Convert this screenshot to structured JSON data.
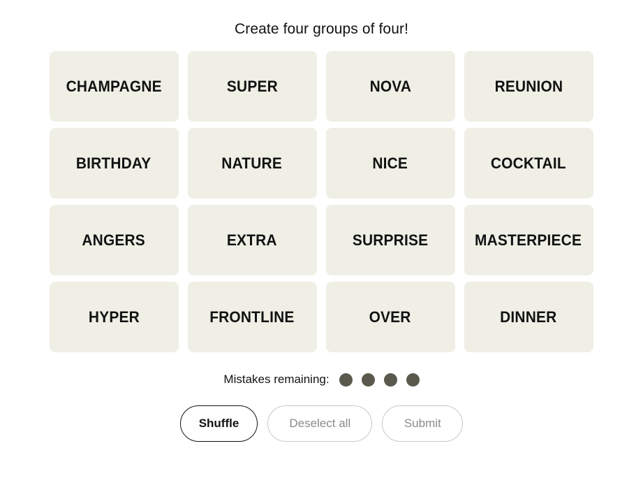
{
  "game": {
    "title": "Create four groups of four!",
    "tiles": [
      {
        "label": "CHAMPAGNE"
      },
      {
        "label": "SUPER"
      },
      {
        "label": "NOVA"
      },
      {
        "label": "REUNION"
      },
      {
        "label": "BIRTHDAY"
      },
      {
        "label": "NATURE"
      },
      {
        "label": "NICE"
      },
      {
        "label": "COCKTAIL"
      },
      {
        "label": "ANGERS"
      },
      {
        "label": "EXTRA"
      },
      {
        "label": "SURPRISE"
      },
      {
        "label": "MASTERPIECE"
      },
      {
        "label": "HYPER"
      },
      {
        "label": "FRONTLINE"
      },
      {
        "label": "OVER"
      },
      {
        "label": "DINNER"
      }
    ],
    "mistakes": {
      "label": "Mistakes remaining:",
      "remaining": 4,
      "dot_color": "#5a594e"
    },
    "buttons": {
      "shuffle": "Shuffle",
      "deselect_all": "Deselect all",
      "submit": "Submit"
    },
    "colors": {
      "tile_background": "#efefe6",
      "page_background": "#ffffff",
      "text": "#121212",
      "muted_text": "#8b8b8b",
      "muted_border": "#c8c8c8"
    }
  }
}
